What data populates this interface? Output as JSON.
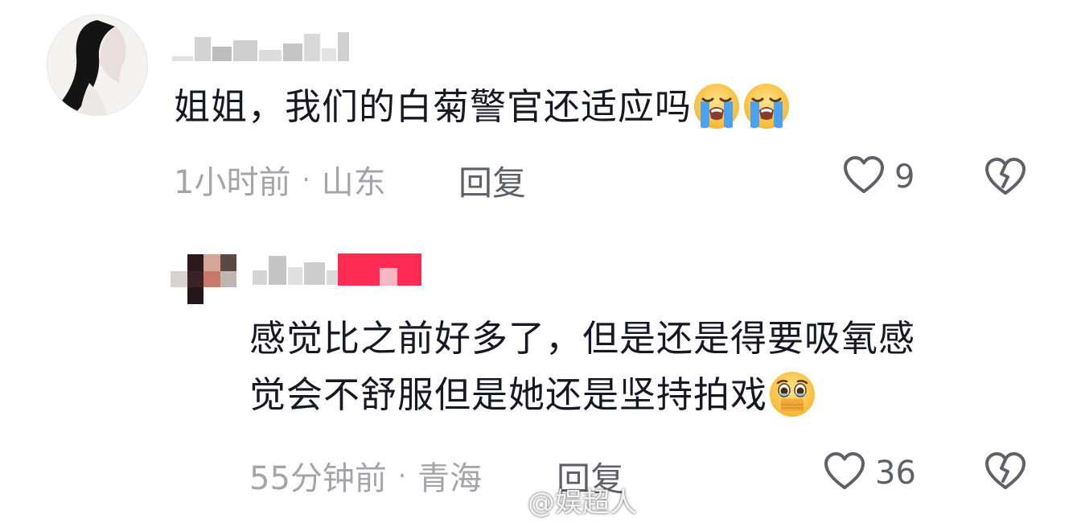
{
  "comment": {
    "text": "姐姐，我们的白菊警官还适应吗",
    "emojis": [
      "loudly-crying-emoji",
      "loudly-crying-emoji"
    ],
    "time": "1小时前",
    "separator": "·",
    "location": "山东",
    "reply_label": "回复",
    "like_count": "9"
  },
  "reply": {
    "text_line1": "感觉比之前好多了，但是还是得要吸氧感",
    "text_line2": "觉会不舒服但是她还是坚持拍戏",
    "emoji": "holding-back-tears-emoji",
    "time": "55分钟前",
    "separator": "·",
    "location": "青海",
    "reply_label": "回复",
    "like_count": "36"
  },
  "watermark": {
    "text": "@娱超人",
    "icon": "weibo-icon"
  },
  "colors": {
    "text": "#161823",
    "meta": "#a4a5aa",
    "badge": "#fe2c55"
  }
}
